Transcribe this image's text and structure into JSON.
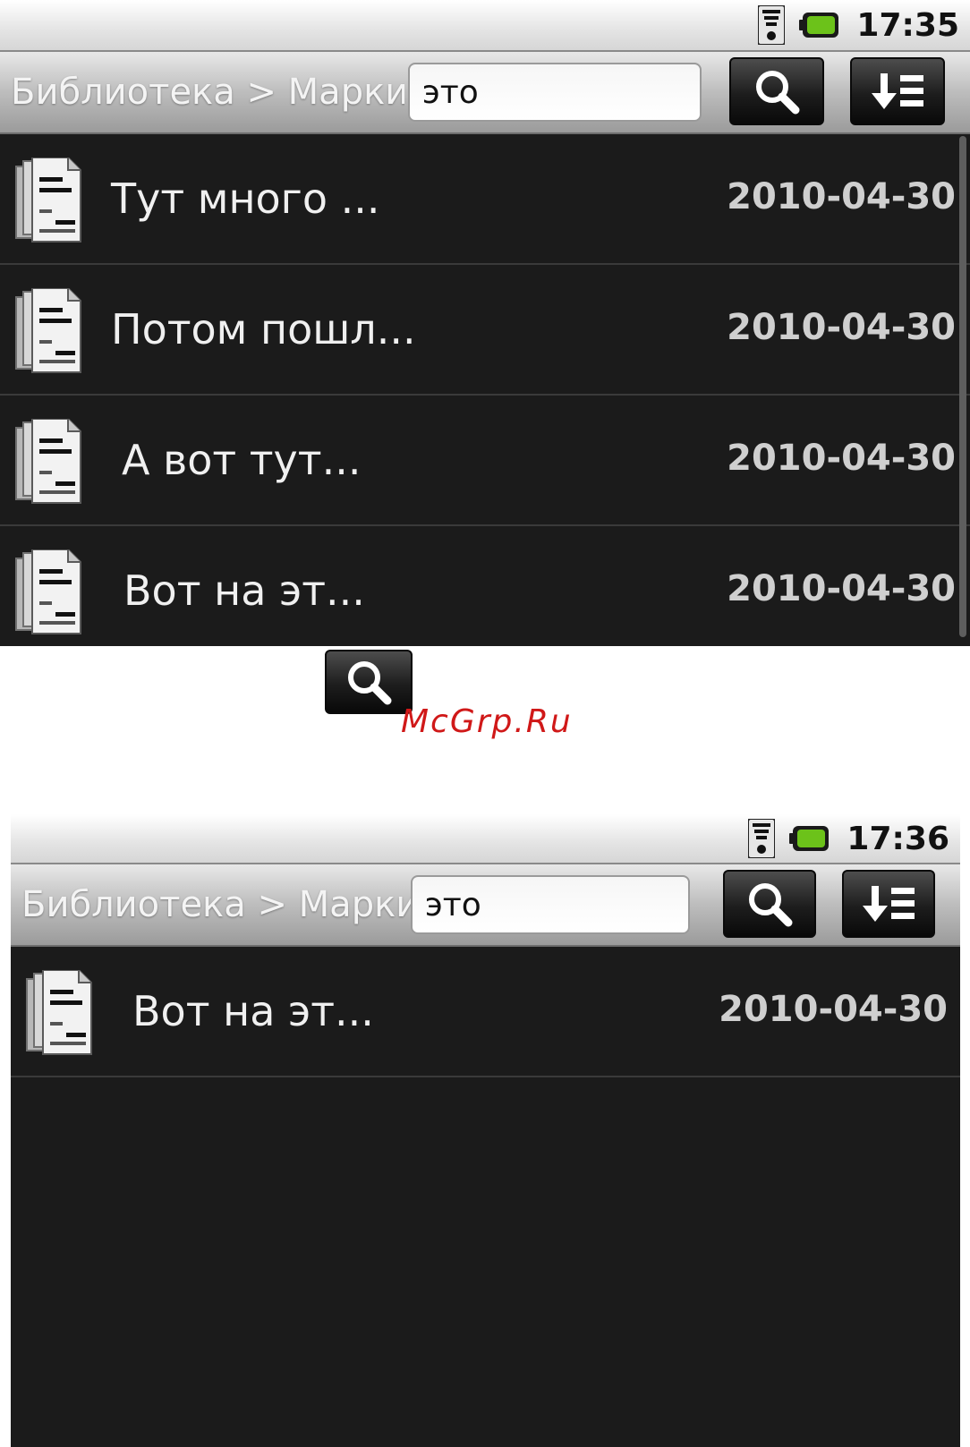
{
  "screens": [
    {
      "status": {
        "time": "17:35"
      },
      "toolbar": {
        "breadcrumb": "Библиотека > Маркировки",
        "search_value": "это"
      },
      "items": [
        {
          "title": "Тут много ...",
          "date": "2010-04-30"
        },
        {
          "title": "Потом пошл...",
          "date": "2010-04-30"
        },
        {
          "title": "А вот тут...",
          "date": "2010-04-30"
        },
        {
          "title": "Вот на эт...",
          "date": "2010-04-30"
        }
      ]
    },
    {
      "status": {
        "time": "17:36"
      },
      "toolbar": {
        "breadcrumb": "Библиотека > Маркировки",
        "search_value": "это"
      },
      "items": [
        {
          "title": "Вот на эт...",
          "date": "2010-04-30"
        }
      ]
    }
  ],
  "watermark": "McGrp.Ru",
  "icons": {
    "search": "search-icon",
    "sort": "sort-icon",
    "document": "document-icon",
    "signal": "signal-icon",
    "battery": "battery-icon"
  },
  "colors": {
    "battery_green": "#6cc21a",
    "watermark": "#d01818"
  }
}
